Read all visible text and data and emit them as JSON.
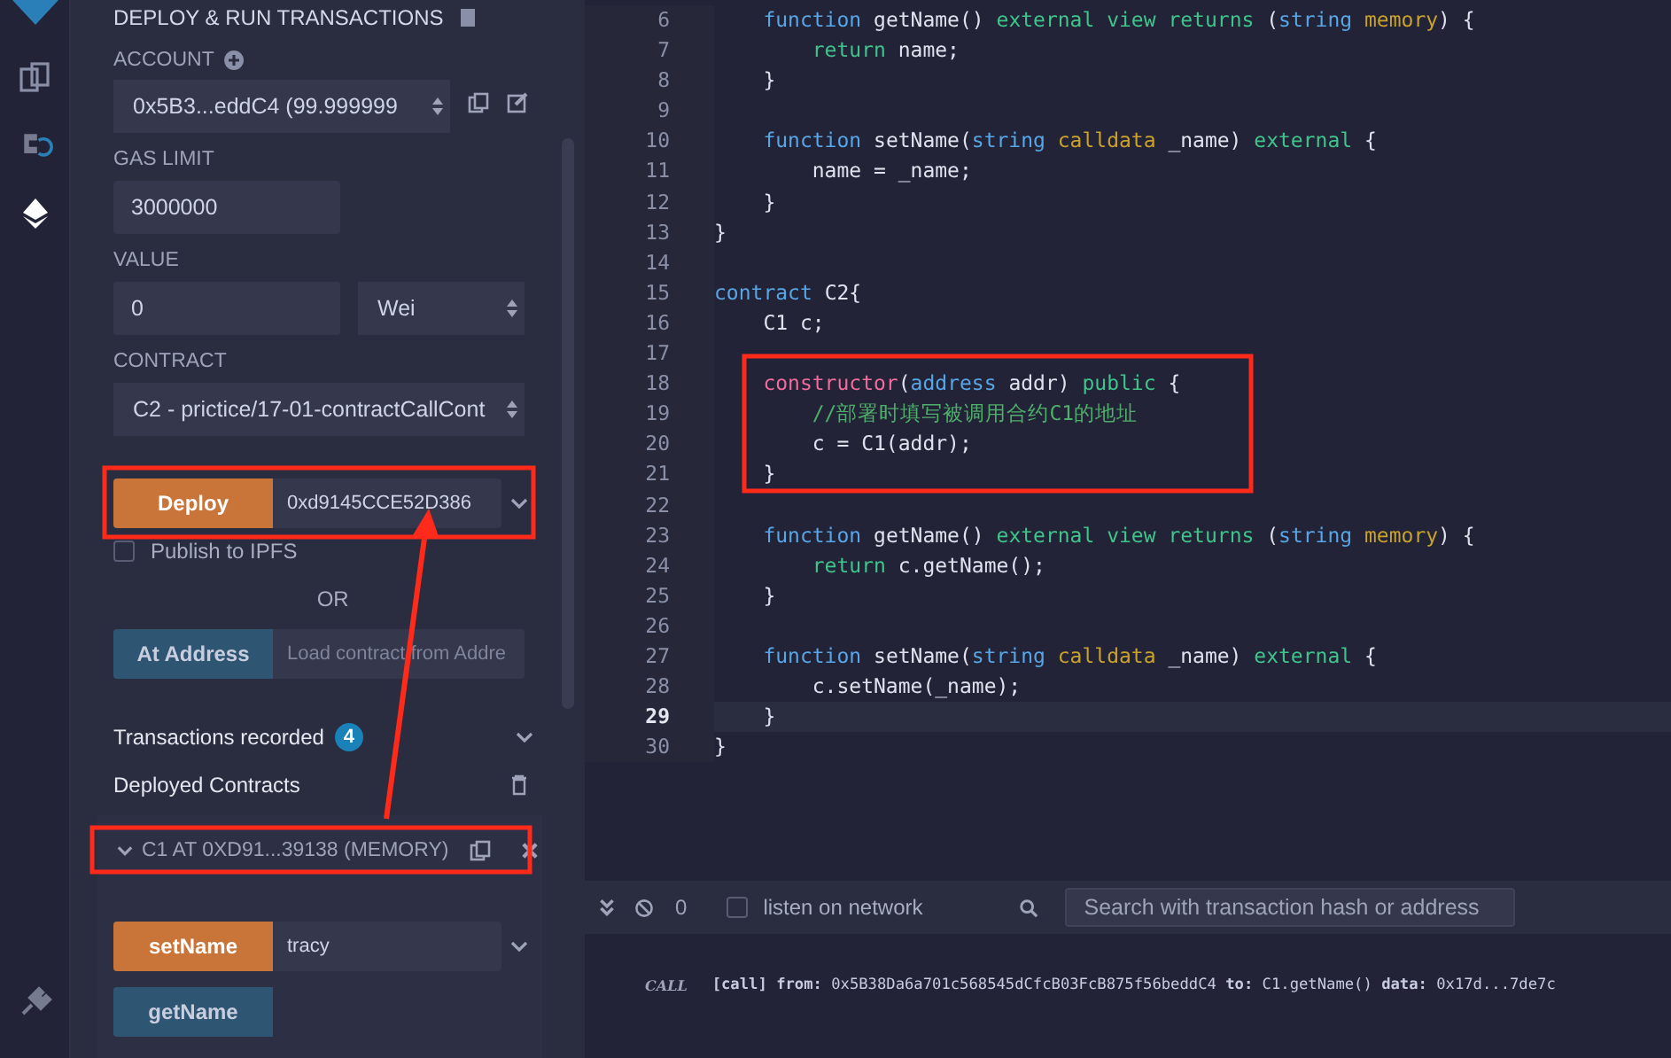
{
  "panel": {
    "title": "DEPLOY & RUN TRANSACTIONS",
    "account": {
      "label": "ACCOUNT",
      "value": "0x5B3...eddC4 (99.999999"
    },
    "gas_limit": {
      "label": "GAS LIMIT",
      "value": "3000000"
    },
    "value": {
      "label": "VALUE",
      "value": "0",
      "unit": "Wei"
    },
    "contract": {
      "label": "CONTRACT",
      "value": "C2 - prictice/17-01-contractCallCont"
    },
    "deploy": {
      "button": "Deploy",
      "value": "0xd9145CCE52D386"
    },
    "publish": {
      "label": "Publish to IPFS",
      "checked": false
    },
    "or": "OR",
    "at_address": {
      "button": "At Address",
      "placeholder": "Load contract from Addre"
    },
    "transactions": {
      "label": "Transactions recorded",
      "count": "4"
    },
    "deployed": {
      "label": "Deployed Contracts"
    },
    "instance": {
      "title": "C1 AT 0XD91...39138 (MEMORY)",
      "expanded": true,
      "functions": [
        {
          "name": "setName",
          "kind": "transact",
          "value": "tracy"
        },
        {
          "name": "getName",
          "kind": "call"
        }
      ]
    }
  },
  "editor": {
    "lines": [
      {
        "number": "6",
        "current": false,
        "tokens": [
          {
            "kind": "type",
            "text": "    function"
          },
          {
            "kind": "plain",
            "text": " getName() "
          },
          {
            "kind": "kw",
            "text": "external view returns"
          },
          {
            "kind": "plain",
            "text": " ("
          },
          {
            "kind": "type",
            "text": "string"
          },
          {
            "kind": "storage",
            "text": " memory"
          },
          {
            "kind": "plain",
            "text": ") {"
          }
        ]
      },
      {
        "number": "7",
        "current": false,
        "tokens": [
          {
            "kind": "kw",
            "text": "        return"
          },
          {
            "kind": "plain",
            "text": " name;"
          }
        ]
      },
      {
        "number": "8",
        "current": false,
        "tokens": [
          {
            "kind": "plain",
            "text": "    }"
          }
        ]
      },
      {
        "number": "9",
        "current": false
      },
      {
        "number": "10",
        "current": false,
        "tokens": [
          {
            "kind": "type",
            "text": "    function"
          },
          {
            "kind": "plain",
            "text": " setName("
          },
          {
            "kind": "type",
            "text": "string"
          },
          {
            "kind": "storage",
            "text": " calldata"
          },
          {
            "kind": "plain",
            "text": " _name) "
          },
          {
            "kind": "kw",
            "text": "external"
          },
          {
            "kind": "plain",
            "text": " {"
          }
        ]
      },
      {
        "number": "11",
        "current": false,
        "tokens": [
          {
            "kind": "plain",
            "text": "        name = _name;"
          }
        ]
      },
      {
        "number": "12",
        "current": false,
        "tokens": [
          {
            "kind": "plain",
            "text": "    }"
          }
        ]
      },
      {
        "number": "13",
        "current": false,
        "tokens": [
          {
            "kind": "plain",
            "text": "}"
          }
        ]
      },
      {
        "number": "14",
        "current": false
      },
      {
        "number": "15",
        "current": false,
        "tokens": [
          {
            "kind": "type",
            "text": "contract"
          },
          {
            "kind": "plain",
            "text": " C2{"
          }
        ]
      },
      {
        "number": "16",
        "current": false,
        "tokens": [
          {
            "kind": "plain",
            "text": "    C1 c;"
          }
        ]
      },
      {
        "number": "17",
        "current": false
      },
      {
        "number": "18",
        "current": false,
        "tokens": [
          {
            "kind": "ctor",
            "text": "    constructor"
          },
          {
            "kind": "plain",
            "text": "("
          },
          {
            "kind": "type",
            "text": "address"
          },
          {
            "kind": "plain",
            "text": " addr) "
          },
          {
            "kind": "kw",
            "text": "public"
          },
          {
            "kind": "plain",
            "text": " {"
          }
        ]
      },
      {
        "number": "19",
        "current": false,
        "tokens": [
          {
            "kind": "comment",
            "text": "        //部署时填写被调用合约C1的地址"
          }
        ]
      },
      {
        "number": "20",
        "current": false,
        "tokens": [
          {
            "kind": "plain",
            "text": "        c = C1(addr);"
          }
        ]
      },
      {
        "number": "21",
        "current": false,
        "tokens": [
          {
            "kind": "plain",
            "text": "    }"
          }
        ]
      },
      {
        "number": "22",
        "current": false
      },
      {
        "number": "23",
        "current": false,
        "tokens": [
          {
            "kind": "type",
            "text": "    function"
          },
          {
            "kind": "plain",
            "text": " getName() "
          },
          {
            "kind": "kw",
            "text": "external view returns"
          },
          {
            "kind": "plain",
            "text": " ("
          },
          {
            "kind": "type",
            "text": "string"
          },
          {
            "kind": "storage",
            "text": " memory"
          },
          {
            "kind": "plain",
            "text": ") {"
          }
        ]
      },
      {
        "number": "24",
        "current": false,
        "tokens": [
          {
            "kind": "kw",
            "text": "        return"
          },
          {
            "kind": "plain",
            "text": " c.getName();"
          }
        ]
      },
      {
        "number": "25",
        "current": false,
        "tokens": [
          {
            "kind": "plain",
            "text": "    }"
          }
        ]
      },
      {
        "number": "26",
        "current": false
      },
      {
        "number": "27",
        "current": false,
        "tokens": [
          {
            "kind": "type",
            "text": "    function"
          },
          {
            "kind": "plain",
            "text": " setName("
          },
          {
            "kind": "type",
            "text": "string"
          },
          {
            "kind": "storage",
            "text": " calldata"
          },
          {
            "kind": "plain",
            "text": " _name) "
          },
          {
            "kind": "kw",
            "text": "external"
          },
          {
            "kind": "plain",
            "text": " {"
          }
        ]
      },
      {
        "number": "28",
        "current": false,
        "tokens": [
          {
            "kind": "plain",
            "text": "        c.setName(_name);"
          }
        ]
      },
      {
        "number": "29",
        "current": true,
        "tokens": [
          {
            "kind": "plain",
            "text": "    }"
          }
        ]
      },
      {
        "number": "30",
        "current": false,
        "tokens": [
          {
            "kind": "plain",
            "text": "}"
          }
        ]
      }
    ]
  },
  "terminal": {
    "count": "0",
    "listen": {
      "label": "listen on network",
      "checked": false
    },
    "search": {
      "placeholder": "Search with transaction hash or address"
    },
    "log": [
      {
        "badge": "CALL",
        "text": "**[call]** **from:** 0x5B38Da6a701c568545dCfcB03FcB875f56beddC4 **to:** C1.getName() **data:** 0x17d...7de7c"
      }
    ]
  }
}
